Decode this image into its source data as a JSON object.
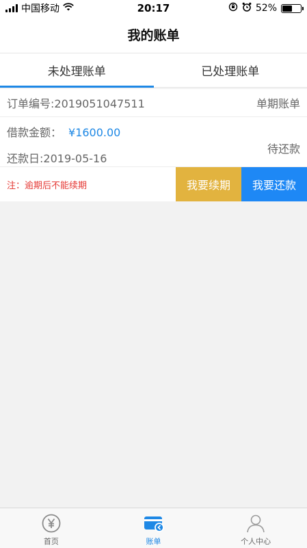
{
  "status_bar": {
    "carrier": "中国移动",
    "time": "20:17",
    "battery_pct": "52%",
    "battery_level": 0.52
  },
  "nav": {
    "title": "我的账单"
  },
  "tabs": [
    {
      "label": "未处理账单",
      "active": true
    },
    {
      "label": "已处理账单",
      "active": false
    }
  ],
  "bill": {
    "order_label": "订单编号:",
    "order_no": "2019051047511",
    "bill_type": "单期账单",
    "amount_label": "借款金额：",
    "amount": "¥1600.00",
    "due_label": "还款日:",
    "due_date": "2019-05-16",
    "status": "待还款",
    "note": "注：逾期后不能续期",
    "renew_label": "我要续期",
    "repay_label": "我要还款"
  },
  "tabbar": [
    {
      "label": "首页",
      "icon": "yen-icon",
      "active": false
    },
    {
      "label": "账单",
      "icon": "bill-card-icon",
      "active": true
    },
    {
      "label": "个人中心",
      "icon": "person-icon",
      "active": false
    }
  ],
  "colors": {
    "accent": "#1e88e5",
    "renew": "#e2b33f",
    "note": "#e53935"
  }
}
